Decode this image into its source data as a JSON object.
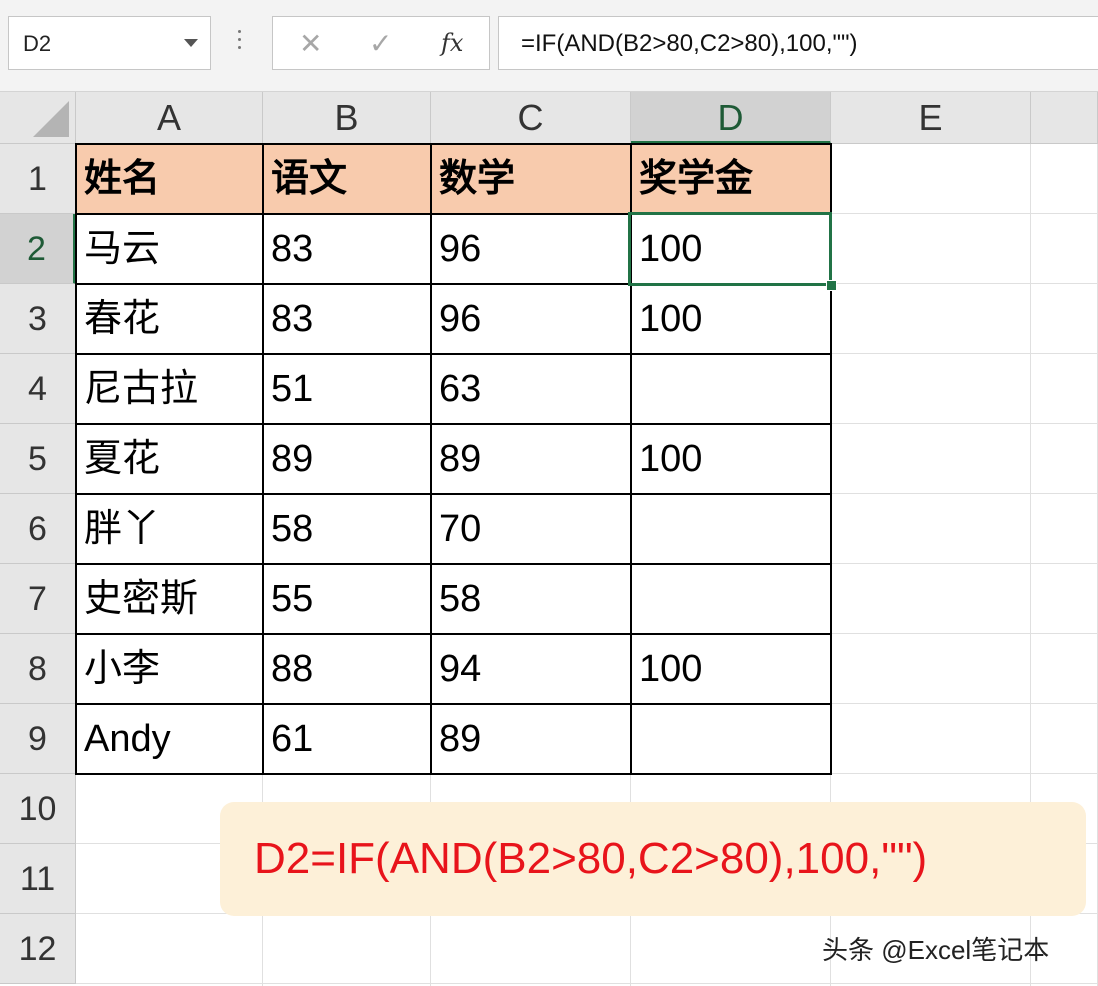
{
  "formula_bar": {
    "name_box": "D2",
    "cancel_glyph": "✕",
    "enter_glyph": "✓",
    "fx_label": "fx",
    "formula": "=IF(AND(B2>80,C2>80),100,\"\")"
  },
  "columns": [
    "A",
    "B",
    "C",
    "D",
    "E"
  ],
  "rows": [
    "1",
    "2",
    "3",
    "4",
    "5",
    "6",
    "7",
    "8",
    "9",
    "10",
    "11",
    "12"
  ],
  "table": {
    "headers": [
      "姓名",
      "语文",
      "数学",
      "奖学金"
    ],
    "rows": [
      [
        "马云",
        "83",
        "96",
        "100"
      ],
      [
        "春花",
        "83",
        "96",
        "100"
      ],
      [
        "尼古拉",
        "51",
        "63",
        ""
      ],
      [
        "夏花",
        "89",
        "89",
        "100"
      ],
      [
        "胖丫",
        "58",
        "70",
        ""
      ],
      [
        "史密斯",
        "55",
        "58",
        ""
      ],
      [
        "小李",
        "88",
        "94",
        "100"
      ],
      [
        "Andy",
        "61",
        "89",
        ""
      ]
    ]
  },
  "selected_cell": "D2",
  "annotation": "D2=IF(AND(B2>80,C2>80),100,\"\")",
  "watermark": "头条 @Excel笔记本",
  "colors": {
    "header_fill": "#f8cbad",
    "selection": "#217346",
    "annotation_text": "#e8141b",
    "annotation_bg": "#fdf0d8"
  }
}
